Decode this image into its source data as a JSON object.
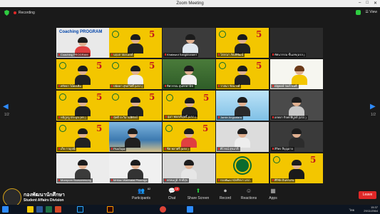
{
  "window": {
    "title": "Zoom Meeting"
  },
  "topbar": {
    "recording_label": "Recording",
    "view_label": "View"
  },
  "pager": {
    "left": "1/2",
    "right": "1/2"
  },
  "participants": [
    {
      "name": "Coaching PROGRAM",
      "banner": "Coaching PROGRAM"
    },
    {
      "name": "นฤมล ปองเมตต์"
    },
    {
      "name": "Khatawut Sangkharaert"
    },
    {
      "name": "โสภณา ภัณพิพัฒน์"
    },
    {
      "name": "ทัศนวรรณ ชั้นเลข(มรภ.)"
    },
    {
      "name": "ศรัทธา ไม้ดงเดิม"
    },
    {
      "name": "ปนัดดา สุขสวัสดิ์ (มรภ.)"
    },
    {
      "name": "ทิพวรรณ สุนทรพานิช"
    },
    {
      "name": "วาสนา รัตนวงศ์"
    },
    {
      "name": "ณัฐพงษ์ ว่องไวเมธี"
    },
    {
      "name": "หนิกูลจู ประมุข (ทร.)"
    },
    {
      "name": "นัทธี ป่ะวิมานพิทักษ์"
    },
    {
      "name": "อุมา ทองบริสุทธิ์ (มรภ.)"
    },
    {
      "name": "Jamie Angsatara"
    },
    {
      "name": "อรทยา กิจพรพิบูลย์ (มรภ.)"
    },
    {
      "name": "เก็จ กาญจนี"
    },
    {
      "name": "PlusToya"
    },
    {
      "name": "ชิต พลาศรี (มรภ.)"
    },
    {
      "name": "ศิโรจน์ สุขมาลี"
    },
    {
      "name": "สิริพร สีบุญอาจ"
    },
    {
      "name": "Moreporn Buasamrsung"
    },
    {
      "name": "MrMan Watthatai Phaenga"
    },
    {
      "name": "พรหมภูมิ ภักดีสุข"
    },
    {
      "name": "กองพัฒนานักศึกษา มรภ."
    },
    {
      "name": "ศิริชัย อินทรเสน"
    }
  ],
  "controls": {
    "participants_label": "Participants",
    "participants_count": "82",
    "chat_label": "Chat",
    "chat_badge": "18",
    "share_label": "Share Screen",
    "record_label": "Record",
    "reactions_label": "Reactions",
    "apps_label": "Apps",
    "leave_label": "Leave"
  },
  "watermark": {
    "line1": "กองพัฒนานักศึกษา",
    "line2": "Student Affairs Division"
  },
  "taskbar": {
    "time": "15:37",
    "date": "29/11/2564",
    "lang": "ไทย"
  },
  "colors": {
    "tile_yellow": "#f3c600",
    "accent_blue": "#2e8bff",
    "record_red": "#e02828",
    "shield_green": "#2ecc40"
  }
}
